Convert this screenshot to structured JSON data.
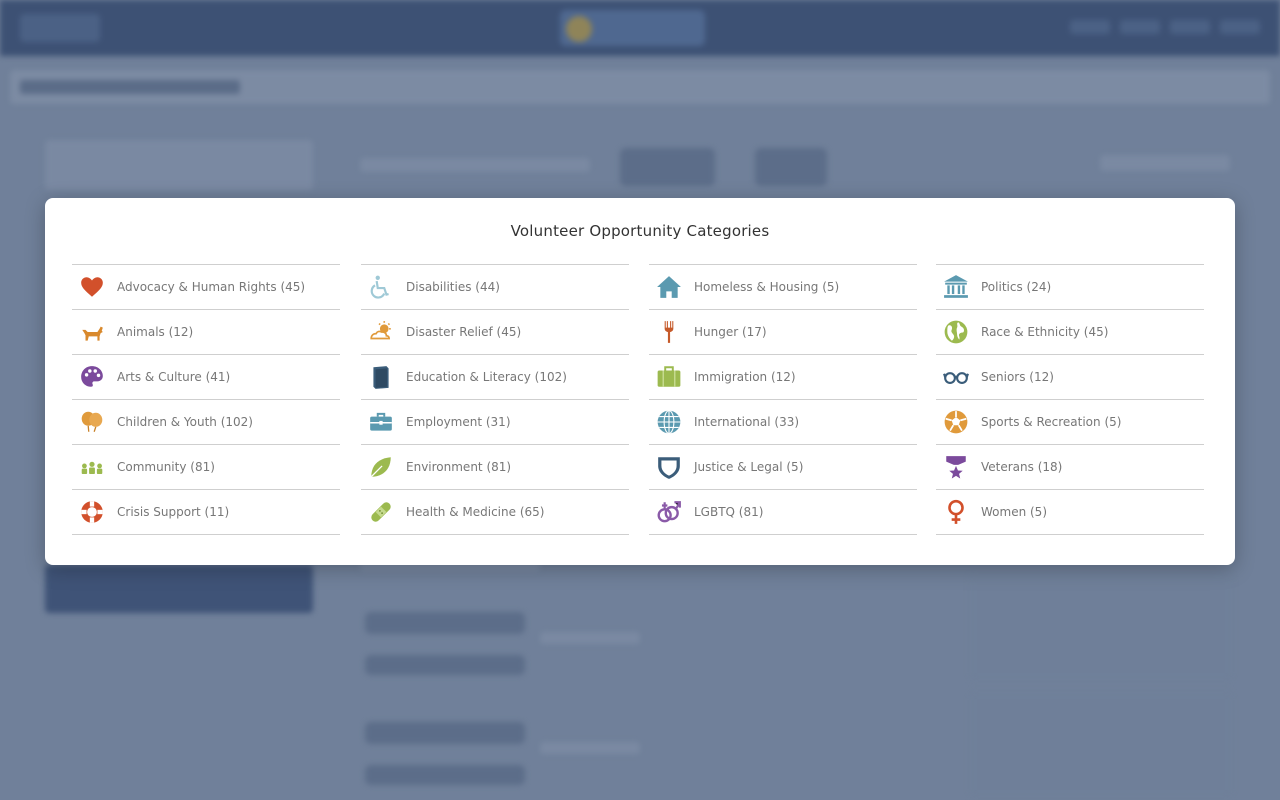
{
  "modal": {
    "title": "Volunteer Opportunity Categories",
    "columns": [
      [
        {
          "label": "Advocacy & Human Rights (45)",
          "icon": "heart-icon",
          "color": "#d2502b"
        },
        {
          "label": "Animals (12)",
          "icon": "dog-icon",
          "color": "#d9892c"
        },
        {
          "label": "Arts & Culture (41)",
          "icon": "palette-icon",
          "color": "#7b4a9c"
        },
        {
          "label": "Children & Youth (102)",
          "icon": "balloons-icon",
          "color": "#e09a3b"
        },
        {
          "label": "Community (81)",
          "icon": "people-icon",
          "color": "#9cba4f"
        },
        {
          "label": "Crisis Support (11)",
          "icon": "life-ring-icon",
          "color": "#d2502b"
        }
      ],
      [
        {
          "label": "Disabilities (44)",
          "icon": "wheelchair-icon",
          "color": "#9fc9d6"
        },
        {
          "label": "Disaster Relief (45)",
          "icon": "storm-icon",
          "color": "#e09a3b"
        },
        {
          "label": "Education & Literacy (102)",
          "icon": "book-icon",
          "color": "#3b5d7a"
        },
        {
          "label": "Employment (31)",
          "icon": "briefcase-icon",
          "color": "#5b9ab0"
        },
        {
          "label": "Environment (81)",
          "icon": "leaf-icon",
          "color": "#9cba4f"
        },
        {
          "label": "Health & Medicine (65)",
          "icon": "bandage-icon",
          "color": "#9cba4f"
        }
      ],
      [
        {
          "label": "Homeless & Housing (5)",
          "icon": "house-icon",
          "color": "#5b9ab0"
        },
        {
          "label": "Hunger (17)",
          "icon": "fork-icon",
          "color": "#c65a2a"
        },
        {
          "label": "Immigration (12)",
          "icon": "suitcase-icon",
          "color": "#9cba4f"
        },
        {
          "label": "International (33)",
          "icon": "globe-icon",
          "color": "#5b9ab0"
        },
        {
          "label": "Justice & Legal (5)",
          "icon": "shield-icon",
          "color": "#3b5d7a"
        },
        {
          "label": "LGBTQ (81)",
          "icon": "gender-symbols-icon",
          "color": "#8a5aa8"
        }
      ],
      [
        {
          "label": "Politics (24)",
          "icon": "capitol-icon",
          "color": "#5b9ab0"
        },
        {
          "label": "Race & Ethnicity (45)",
          "icon": "earth-icon",
          "color": "#9cba4f"
        },
        {
          "label": "Seniors (12)",
          "icon": "glasses-icon",
          "color": "#3b5d7a"
        },
        {
          "label": "Sports & Recreation (5)",
          "icon": "soccer-ball-icon",
          "color": "#e09a3b"
        },
        {
          "label": "Veterans (18)",
          "icon": "medal-icon",
          "color": "#7b4a9c"
        },
        {
          "label": "Women (5)",
          "icon": "female-symbol-icon",
          "color": "#d2502b"
        }
      ]
    ]
  }
}
